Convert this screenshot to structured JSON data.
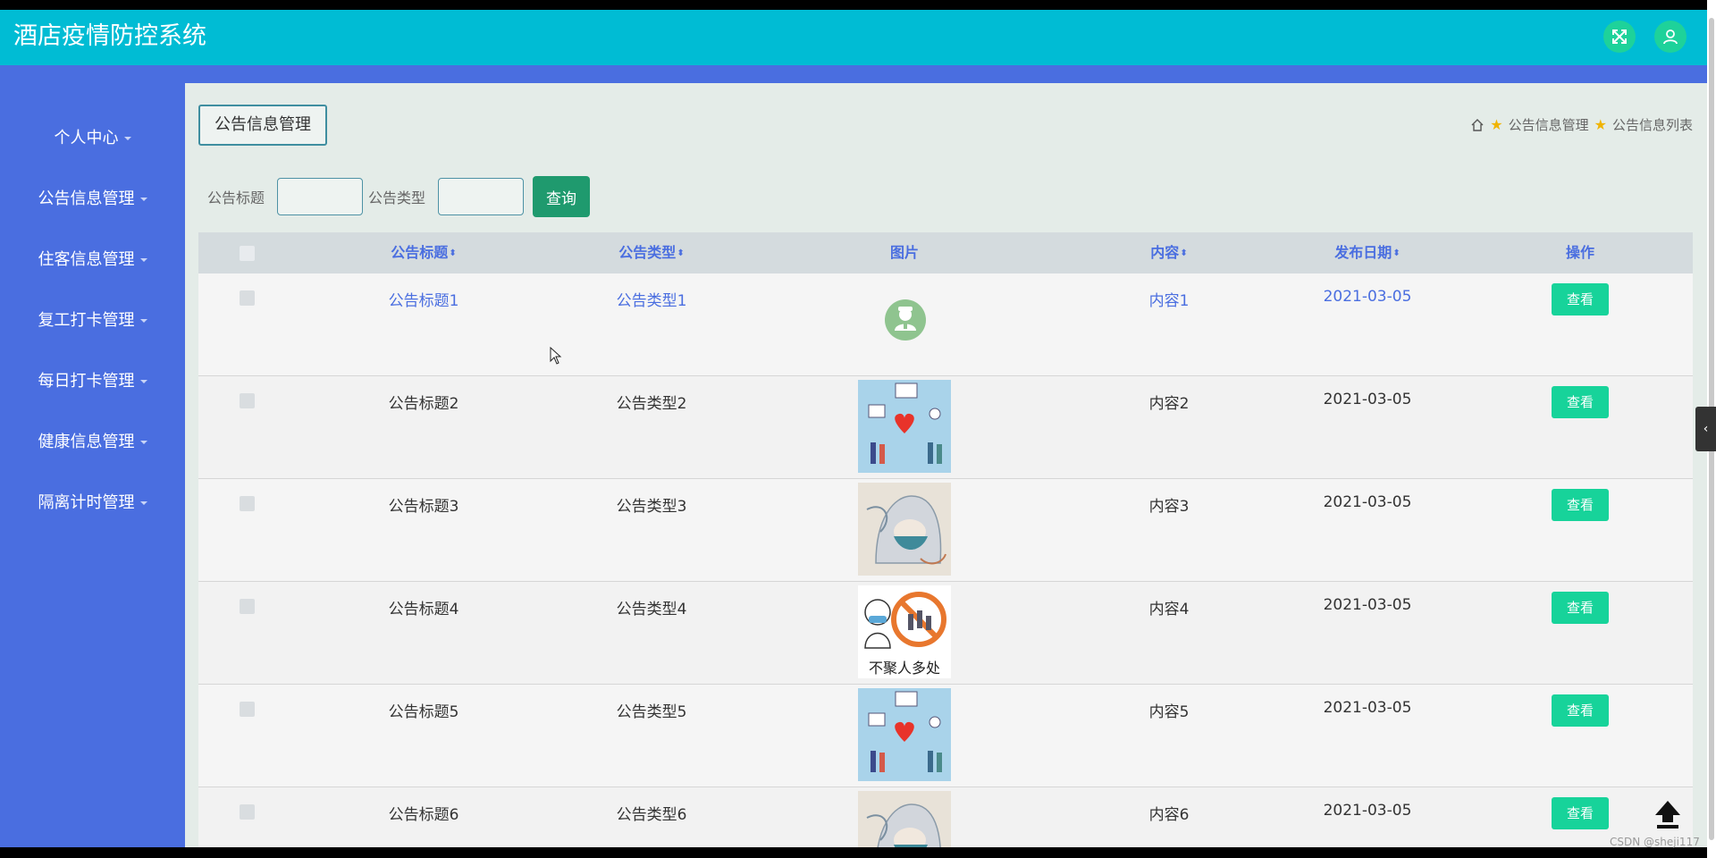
{
  "app": {
    "title": "酒店疫情防控系统"
  },
  "header": {
    "fullscreen_icon": "expand-icon",
    "user_icon": "user-icon"
  },
  "sidebar": {
    "items": [
      {
        "label": "个人中心"
      },
      {
        "label": "公告信息管理"
      },
      {
        "label": "住客信息管理"
      },
      {
        "label": "复工打卡管理"
      },
      {
        "label": "每日打卡管理"
      },
      {
        "label": "健康信息管理"
      },
      {
        "label": "隔离计时管理"
      }
    ]
  },
  "page": {
    "tab_label": "公告信息管理",
    "breadcrumb": [
      "公告信息管理",
      "公告信息列表"
    ]
  },
  "search": {
    "title_label": "公告标题",
    "title_value": "",
    "type_label": "公告类型",
    "type_value": "",
    "button_label": "查询"
  },
  "table": {
    "headers": {
      "title": "公告标题",
      "type": "公告类型",
      "image": "图片",
      "content": "内容",
      "date": "发布日期",
      "action": "操作"
    },
    "rows": [
      {
        "title": "公告标题1",
        "type": "公告类型1",
        "content": "内容1",
        "date": "2021-03-05",
        "action": "查看",
        "image": "doctor-avatar"
      },
      {
        "title": "公告标题2",
        "type": "公告类型2",
        "content": "内容2",
        "date": "2021-03-05",
        "action": "查看",
        "image": "medical-heart-illustration"
      },
      {
        "title": "公告标题3",
        "type": "公告类型3",
        "content": "内容3",
        "date": "2021-03-05",
        "action": "查看",
        "image": "medical-worker-sketch"
      },
      {
        "title": "公告标题4",
        "type": "公告类型4",
        "content": "内容4",
        "date": "2021-03-05",
        "action": "查看",
        "image": "no-gathering-poster",
        "image_caption": "不聚人多处"
      },
      {
        "title": "公告标题5",
        "type": "公告类型5",
        "content": "内容5",
        "date": "2021-03-05",
        "action": "查看",
        "image": "medical-heart-illustration"
      },
      {
        "title": "公告标题6",
        "type": "公告类型6",
        "content": "内容6",
        "date": "2021-03-05",
        "action": "查看",
        "image": "medical-worker-sketch"
      }
    ]
  },
  "watermark": "CSDN @sheji117",
  "colors": {
    "header": "#00bcd4",
    "sidebar": "#4a6ee0",
    "accent_button": "#17d39a",
    "query_button": "#1f9a6e"
  }
}
